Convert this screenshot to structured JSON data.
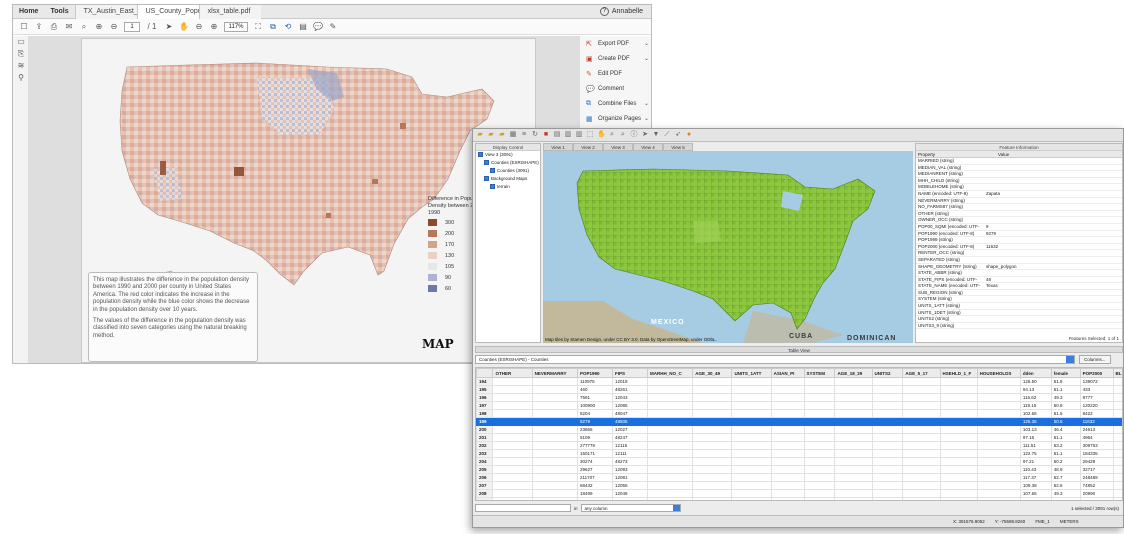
{
  "pdf": {
    "menu": [
      "Home",
      "Tools"
    ],
    "tabs": [
      "TX_Austin_East_2...",
      "US_County_Popul...",
      "xlsx_table.pdf"
    ],
    "user": "Annabelle",
    "page_current": "1",
    "page_total": "/ 1",
    "zoom": "117%",
    "legend_title": "Difference in Population Density between 2000 & 1990",
    "legend": [
      {
        "label": "300",
        "color": "#8c4a2e"
      },
      {
        "label": "200",
        "color": "#b8775a"
      },
      {
        "label": "170",
        "color": "#d4a38b"
      },
      {
        "label": "130",
        "color": "#ead1c3"
      },
      {
        "label": "105",
        "color": "#e7e7ea"
      },
      {
        "label": "90",
        "color": "#aeb4cf"
      },
      {
        "label": "60",
        "color": "#6c78a9"
      }
    ],
    "description": [
      "This map illustrates the difference in the population density between 1990 and 2000 per county in United States America. The red color indicates the increase in the population density while the blue color shows the decrease in the population density over 10 years.",
      "The values of the difference in the population density was classified into seven categories using the natural breaking method."
    ],
    "logo": "MAP",
    "tools": [
      "Export PDF",
      "Create PDF",
      "Edit PDF",
      "Comment",
      "Combine Files",
      "Organize Pages"
    ]
  },
  "gis": {
    "display_control_title": "Display Control",
    "tree": [
      "View 3 (3091)",
      "Counties (ESRISHAPE)",
      "Counties (3091)",
      "Background Maps",
      "terrain"
    ],
    "view_tabs": [
      "View 1",
      "View 2",
      "View 3",
      "View 4",
      "View 5"
    ],
    "map_labels": {
      "mexico": "MEXICO",
      "cuba": "CUBA",
      "dominican": "DOMINICAN"
    },
    "attribution": "Map tiles by Stamen Design, under CC BY 3.0. Data by OpenStreetMap, under ODbL.",
    "feature_info_title": "Feature Information",
    "feature_columns": [
      "Property",
      "Value"
    ],
    "feature_rows": [
      {
        "p": "MARRIED (string)",
        "v": ""
      },
      {
        "p": "MEDIAN_VAL (string)",
        "v": ""
      },
      {
        "p": "MEDIANRENT (string)",
        "v": ""
      },
      {
        "p": "MHH_CHILD (string)",
        "v": ""
      },
      {
        "p": "MOBILEHOME (string)",
        "v": ""
      },
      {
        "p": "NAME (encoded: UTF-8)",
        "v": "Zapata"
      },
      {
        "p": "NEVERMARRY (string)",
        "v": ""
      },
      {
        "p": "NO_FARMS87 (string)",
        "v": ""
      },
      {
        "p": "OTHER (string)",
        "v": ""
      },
      {
        "p": "OWNER_OCC (string)",
        "v": ""
      },
      {
        "p": "POP00_SQMI (encoded: UTF-",
        "v": "9"
      },
      {
        "p": "POP1990 (encoded: UTF-8)",
        "v": "9279"
      },
      {
        "p": "POP1999 (string)",
        "v": ""
      },
      {
        "p": "POP2000 (encoded: UTF-8)",
        "v": "11632"
      },
      {
        "p": "RENTER_OCC (string)",
        "v": ""
      },
      {
        "p": "SEPARATED (string)",
        "v": ""
      },
      {
        "p": "SHAPE_GEOMETRY (string)",
        "v": "shape_polygon"
      },
      {
        "p": "STATE_ABBR (string)",
        "v": ""
      },
      {
        "p": "STATE_FIPS (encoded: UTF-",
        "v": "48"
      },
      {
        "p": "STATE_NAME (encoded: UTF-",
        "v": "Texas"
      },
      {
        "p": "SUB_REGION (string)",
        "v": ""
      },
      {
        "p": "SYSTEM (string)",
        "v": ""
      },
      {
        "p": "UNITS_1ATT (string)",
        "v": ""
      },
      {
        "p": "UNITS_1DET (string)",
        "v": ""
      },
      {
        "p": "UNITS2 (string)",
        "v": ""
      },
      {
        "p": "UNITS3_9 (string)",
        "v": ""
      }
    ],
    "features_selected": "Features Selected:",
    "features_page": "1 of 1",
    "table_view_title": "Table View",
    "layer": "Counties (ESRISHAPE) - Counties",
    "columns_button": "Columns...",
    "columns": [
      "",
      "OTHER",
      "NEVERMARRY",
      "POP1990",
      "FIPS",
      "MARHH_NO_C",
      "AGE_30_49",
      "UNITS_1ATT",
      "ASIAN_PI",
      "SYSTEM",
      "AGE_18_29",
      "UNITS2",
      "AGE_5_17",
      "HSEHLD_1_F",
      "HOUSEHOLDS",
      "dden",
      "female",
      "POP2000",
      "BL"
    ],
    "rows": [
      [
        "194",
        "",
        "",
        "110975",
        "12019",
        "",
        "",
        "",
        "",
        "",
        "",
        "",
        "",
        "",
        "",
        "126.50",
        "51.8",
        "139072",
        ""
      ],
      [
        "195",
        "",
        "",
        "460",
        "48261",
        "",
        "",
        "",
        "",
        "",
        "",
        "",
        "",
        "",
        "",
        "94.13",
        "51.1",
        "433",
        ""
      ],
      [
        "196",
        "",
        "",
        "7591",
        "12043",
        "",
        "",
        "",
        "",
        "",
        "",
        "",
        "",
        "",
        "",
        "115.62",
        "49.3",
        "8777",
        ""
      ],
      [
        "197",
        "",
        "",
        "100900",
        "12085",
        "",
        "",
        "",
        "",
        "",
        "",
        "",
        "",
        "",
        "",
        "119.15",
        "50.8",
        "120220",
        ""
      ],
      [
        "198",
        "",
        "",
        "8204",
        "48047",
        "",
        "",
        "",
        "",
        "",
        "",
        "",
        "",
        "",
        "",
        "102.66",
        "51.5",
        "8422",
        ""
      ],
      [
        "199",
        "",
        "",
        "9279",
        "48505",
        "",
        "",
        "",
        "",
        "",
        "",
        "",
        "",
        "",
        "",
        "125.36",
        "50.6",
        "11632",
        ""
      ],
      [
        "200",
        "",
        "",
        "23865",
        "12027",
        "",
        "",
        "",
        "",
        "",
        "",
        "",
        "",
        "",
        "",
        "103.13",
        "46.4",
        "24613",
        ""
      ],
      [
        "201",
        "",
        "",
        "5109",
        "48247",
        "",
        "",
        "",
        "",
        "",
        "",
        "",
        "",
        "",
        "",
        "97.16",
        "51.1",
        "4964",
        ""
      ],
      [
        "202",
        "",
        "",
        "277776",
        "12115",
        "",
        "",
        "",
        "",
        "",
        "",
        "",
        "",
        "",
        "",
        "111.51",
        "53.2",
        "309753",
        ""
      ],
      [
        "203",
        "",
        "",
        "150171",
        "12111",
        "",
        "",
        "",
        "",
        "",
        "",
        "",
        "",
        "",
        "",
        "122.75",
        "51.1",
        "184335",
        ""
      ],
      [
        "204",
        "",
        "",
        "30274",
        "48273",
        "",
        "",
        "",
        "",
        "",
        "",
        "",
        "",
        "",
        "",
        "97.21",
        "50.2",
        "29429",
        ""
      ],
      [
        "205",
        "",
        "",
        "29627",
        "12093",
        "",
        "",
        "",
        "",
        "",
        "",
        "",
        "",
        "",
        "",
        "110.43",
        "48.9",
        "32717",
        ""
      ],
      [
        "206",
        "",
        "",
        "211707",
        "12081",
        "",
        "",
        "",
        "",
        "",
        "",
        "",
        "",
        "",
        "",
        "117.37",
        "52.7",
        "248489",
        ""
      ],
      [
        "207",
        "",
        "",
        "68432",
        "12055",
        "",
        "",
        "",
        "",
        "",
        "",
        "",
        "",
        "",
        "",
        "109.38",
        "52.6",
        "74852",
        ""
      ],
      [
        "208",
        "",
        "",
        "18499",
        "12049",
        "",
        "",
        "",
        "",
        "",
        "",
        "",
        "",
        "",
        "",
        "107.65",
        "49.3",
        "20990",
        ""
      ],
      [
        "209",
        "",
        "",
        "297465",
        "48355",
        "",
        "",
        "",
        "",
        "",
        "",
        "",
        "",
        "",
        "",
        "106.10",
        "51.1",
        "315868",
        ""
      ],
      [
        "210",
        "",
        "",
        "90208",
        "12061",
        "",
        "",
        "",
        "",
        "",
        "",
        "",
        "",
        "",
        "",
        "112.50",
        "51.7",
        "101496",
        ""
      ]
    ],
    "selected_row": 5,
    "search_scope_label": "in",
    "search_scope": "any column",
    "selection_info": "1 selected / 3091 row(s)",
    "status_x": "X: 391576.9052",
    "status_y": "Y: -75598.8260",
    "status_crs": "FME_1",
    "status_units": "METERS"
  },
  "colors": {
    "accent_blue": "#1a6fe0",
    "map_green": "#8dc63f",
    "pdf_red_tool": "#c0392b"
  }
}
